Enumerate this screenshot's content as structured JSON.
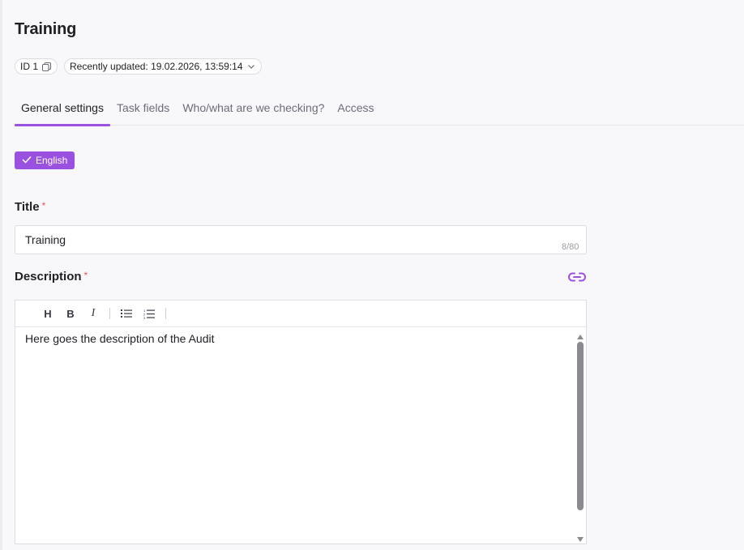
{
  "header": {
    "title": "Training",
    "id_label": "ID 1",
    "updated_label": "Recently updated: 19.02.2026, 13:59:14"
  },
  "tabs": [
    {
      "label": "General settings",
      "active": true
    },
    {
      "label": "Task fields",
      "active": false
    },
    {
      "label": "Who/what are we checking?",
      "active": false
    },
    {
      "label": "Access",
      "active": false
    }
  ],
  "language": {
    "label": "English",
    "icon": "check-icon"
  },
  "form": {
    "title_label": "Title",
    "title_value": "Training",
    "title_counter": "8/80",
    "required_mark": "*",
    "description_label": "Description",
    "description_text": "Here goes the description of the Audit"
  },
  "toolbar": {
    "heading": "H",
    "bold": "B",
    "italic": "I"
  },
  "colors": {
    "accent": "#9b51e0",
    "required": "#e2545c"
  }
}
